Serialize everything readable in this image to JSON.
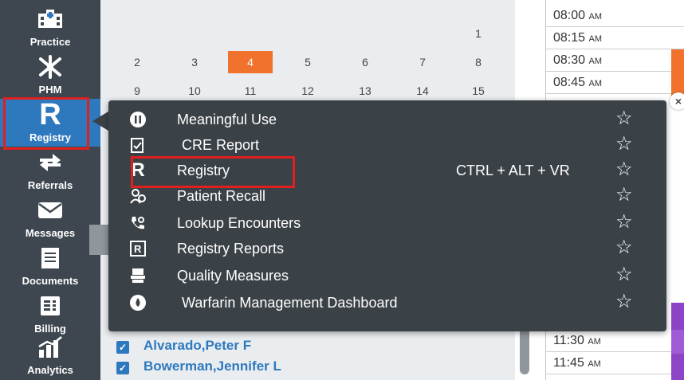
{
  "sidebar": {
    "items": [
      {
        "label": "Practice",
        "icon": "hospital-icon"
      },
      {
        "label": "PHM",
        "icon": "network-icon"
      },
      {
        "label": "Registry",
        "icon": "registry-r-icon",
        "glyph": "R",
        "active": true
      },
      {
        "label": "Referrals",
        "icon": "arrows-icon"
      },
      {
        "label": "Messages",
        "icon": "envelope-icon"
      },
      {
        "label": "Documents",
        "icon": "document-icon"
      },
      {
        "label": "Billing",
        "icon": "billing-icon"
      },
      {
        "label": "Analytics",
        "icon": "chart-icon"
      }
    ]
  },
  "calendar": {
    "days": [
      {
        "n": "1",
        "row": 0,
        "col": 6
      },
      {
        "n": "2",
        "row": 1,
        "col": 0
      },
      {
        "n": "3",
        "row": 1,
        "col": 1
      },
      {
        "n": "4",
        "row": 1,
        "col": 2,
        "today": true
      },
      {
        "n": "5",
        "row": 1,
        "col": 3
      },
      {
        "n": "6",
        "row": 1,
        "col": 4
      },
      {
        "n": "7",
        "row": 1,
        "col": 5
      },
      {
        "n": "8",
        "row": 1,
        "col": 6
      },
      {
        "n": "9",
        "row": 2,
        "col": 0
      },
      {
        "n": "10",
        "row": 2,
        "col": 1
      },
      {
        "n": "11",
        "row": 2,
        "col": 2
      },
      {
        "n": "12",
        "row": 2,
        "col": 3
      },
      {
        "n": "13",
        "row": 2,
        "col": 4
      },
      {
        "n": "14",
        "row": 2,
        "col": 5
      },
      {
        "n": "15",
        "row": 2,
        "col": 6
      }
    ]
  },
  "timeslots": [
    {
      "time": "08:00",
      "ampm": "AM"
    },
    {
      "time": "08:15",
      "ampm": "AM"
    },
    {
      "time": "08:30",
      "ampm": "AM"
    },
    {
      "time": "08:45",
      "ampm": "AM"
    }
  ],
  "timeslots_bottom": [
    {
      "time": "11:30",
      "ampm": "AM"
    },
    {
      "time": "11:45",
      "ampm": "AM"
    }
  ],
  "menu": {
    "items": [
      {
        "label": "Meaningful Use",
        "icon": "meaningful-use-icon",
        "glyph": "Ⓜ"
      },
      {
        "label": "CRE Report",
        "icon": "cre-report-icon",
        "glyph": "☷"
      },
      {
        "label": "Registry",
        "icon": "registry-icon",
        "glyph": "R",
        "shortcut": "CTRL + ALT + VR",
        "highlighted": true
      },
      {
        "label": "Patient Recall",
        "icon": "patient-recall-icon",
        "glyph": "☺"
      },
      {
        "label": "Lookup Encounters",
        "icon": "lookup-encounters-icon",
        "glyph": "☎"
      },
      {
        "label": "Registry Reports",
        "icon": "registry-reports-icon",
        "glyph": "R"
      },
      {
        "label": "Quality Measures",
        "icon": "quality-measures-icon",
        "glyph": "☰"
      },
      {
        "label": "Warfarin Management Dashboard",
        "icon": "warfarin-icon",
        "glyph": "●"
      }
    ],
    "star_glyph": "☆",
    "close_glyph": "×"
  },
  "patients": [
    {
      "name": "Alvarado,Peter F"
    },
    {
      "name": "Bowerman,Jennifer L"
    }
  ],
  "colors": {
    "sidebar_bg": "#3e474f",
    "active_bg": "#2e79bd",
    "popup_bg": "#3b4247",
    "highlight_red": "#e0201f",
    "today_orange": "#f0722d",
    "link_blue": "#2e79bd"
  }
}
